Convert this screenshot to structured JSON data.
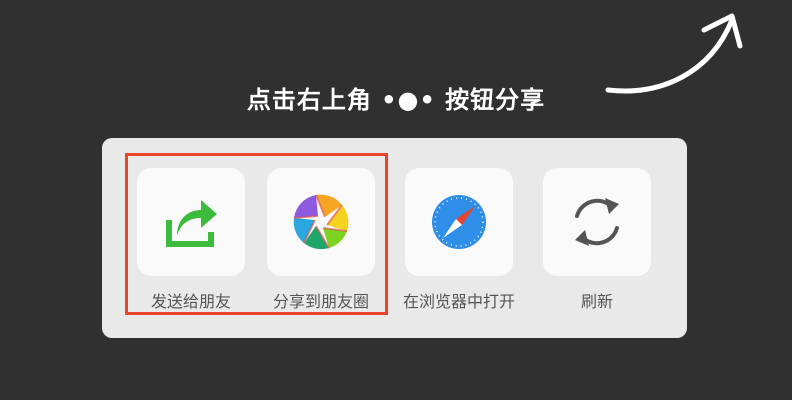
{
  "overlay": {
    "hint_text": "点击右上角 •●• 按钮分享",
    "highlight_color": "#e8452c"
  },
  "share_panel": {
    "actions": [
      {
        "id": "send-to-friend",
        "label": "发送给朋友",
        "icon": "share-arrow-icon",
        "color": "#3dbb3d"
      },
      {
        "id": "share-to-moments",
        "label": "分享到朋友圈",
        "icon": "moments-aperture-icon"
      },
      {
        "id": "open-in-browser",
        "label": "在浏览器中打开",
        "icon": "compass-icon",
        "color": "#2f8ee8"
      },
      {
        "id": "refresh",
        "label": "刷新",
        "icon": "refresh-icon",
        "color": "#555555"
      }
    ]
  }
}
